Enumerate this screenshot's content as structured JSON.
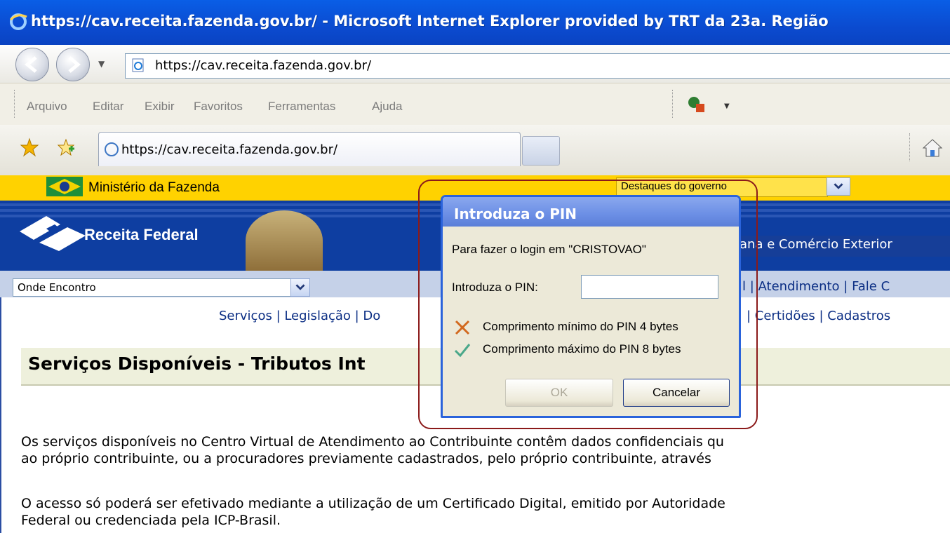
{
  "window": {
    "title": "https://cav.receita.fazenda.gov.br/ - Microsoft Internet Explorer provided by TRT da 23a. Região"
  },
  "address": {
    "url": "https://cav.receita.fazenda.gov.br/"
  },
  "menu": {
    "items": [
      "Arquivo",
      "Editar",
      "Exibir",
      "Favoritos",
      "Ferramentas",
      "Ajuda"
    ]
  },
  "tab": {
    "label": "https://cav.receita.fazenda.gov.br/"
  },
  "gov": {
    "label": "Ministério da Fazenda",
    "select_value": "Destaques do governo"
  },
  "header": {
    "brand": "Receita Federal",
    "right_link": "ana e Comércio Exterior"
  },
  "onde": {
    "select_value": "Onde Encontro",
    "links": "l  |  Atendimento  |  Fale C"
  },
  "nav": {
    "left": "Serviços |  Legislação |  Do",
    "right": "|  Certidões |  Cadastros"
  },
  "heading": "Serviços Disponíveis - Tributos Int",
  "paragraphs": [
    "Os serviços disponíveis no Centro Virtual de Atendimento ao Contribuinte contêm dados confidenciais qu",
    "ao próprio contribuinte, ou a procuradores previamente cadastrados, pelo próprio contribuinte, através",
    "O acesso só poderá ser efetivado mediante a utilização de um Certificado Digital, emitido por Autoridade",
    "Federal ou credenciada pela ICP-Brasil."
  ],
  "dialog": {
    "title": "Introduza o PIN",
    "login_text": "Para fazer o login em \"CRISTOVAO\"",
    "pin_label": "Introduza o PIN:",
    "pin_value": "",
    "rule_min": "Comprimento mínimo do PIN 4 bytes",
    "rule_max": "Comprimento máximo do PIN 8 bytes",
    "ok_label": "OK",
    "cancel_label": "Cancelar"
  },
  "colors": {
    "gov_yellow": "#ffd200",
    "rf_blue": "#0e3ea1",
    "xp_title": "#0b4bd0",
    "highlight": "#8b1a1a"
  },
  "icons": [
    "ie-logo-icon",
    "back-icon",
    "forward-icon",
    "page-icon",
    "tools-icon",
    "favorites-star-icon",
    "add-favorite-icon",
    "loading-icon",
    "home-icon",
    "flag-icon",
    "receita-logo-icon",
    "x-mark-icon",
    "check-mark-icon",
    "dropdown-arrow-icon"
  ]
}
